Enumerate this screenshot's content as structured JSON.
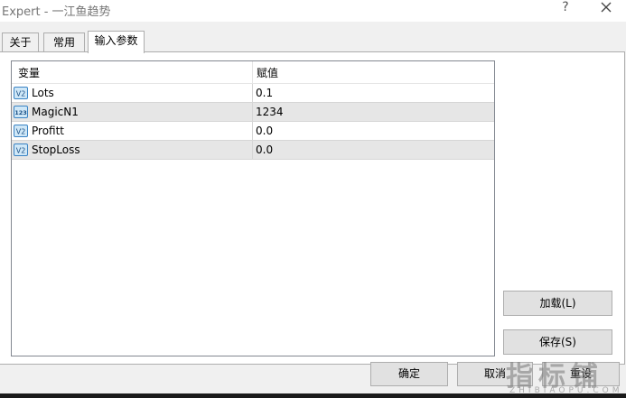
{
  "window": {
    "title": "Expert - 一江鱼趋势",
    "help_glyph": "?"
  },
  "tabs": [
    {
      "label": "关于"
    },
    {
      "label": "常用"
    },
    {
      "label": "输入参数"
    }
  ],
  "grid": {
    "headers": {
      "variable": "变量",
      "value": "赋值"
    },
    "rows": [
      {
        "name": "Lots",
        "value": "0.1",
        "icon": "v2-icon"
      },
      {
        "name": "MagicN1",
        "value": "1234",
        "icon": "123-icon"
      },
      {
        "name": "Profitt",
        "value": "0.0",
        "icon": "v2-icon"
      },
      {
        "name": "StopLoss",
        "value": "0.0",
        "icon": "v2-icon"
      }
    ],
    "icon_text": {
      "v2": "V2",
      "n123": "123"
    }
  },
  "buttons": {
    "load": "加载(L)",
    "save": "保存(S)",
    "ok": "确定",
    "cancel": "取消",
    "reset": "重设"
  },
  "watermark": {
    "text": "指标铺",
    "sub": "ZHIBIAOPU.COM"
  }
}
